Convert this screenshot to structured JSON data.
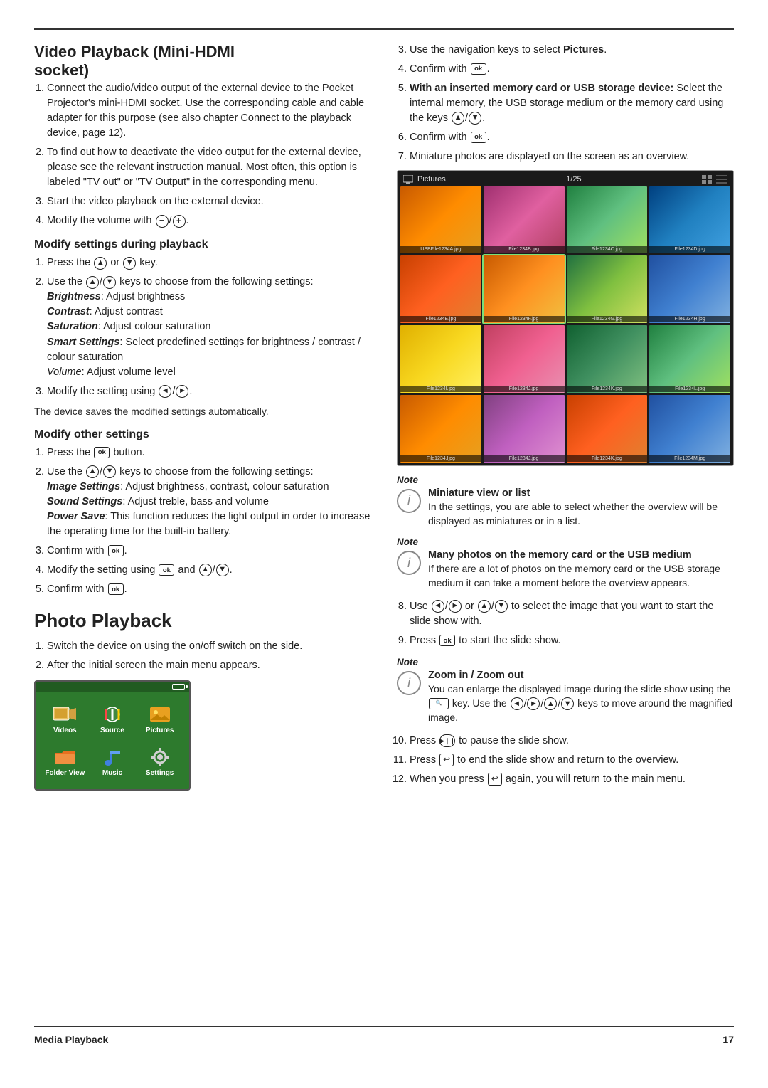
{
  "page": {
    "footer": {
      "left": "Media Playback",
      "right": "17"
    }
  },
  "left_column": {
    "section1": {
      "title_line1": "Video Playback (Mini-HDMI",
      "title_line2": "socket)",
      "items": [
        "Connect the audio/video output of the external device to the Pocket Projector's mini-HDMI socket. Use the corresponding cable and cable adapter for this purpose (see also chapter Connect to the playback device, page 12).",
        "To find out how to deactivate the video output for the external device, please see the relevant instruction manual. Most often, this option is labeled \"TV out\" or \"TV Output\" in the corresponding menu.",
        "Start the video playback on the external device.",
        "Modify the volume with"
      ],
      "item4_suffix": ".",
      "modify_settings": {
        "title": "Modify settings during playback",
        "items": [
          "Press the",
          "Use the",
          "Modify the setting using"
        ],
        "item1_middle": "or",
        "item1_suffix": "key.",
        "item2_middle": "keys to choose from the following settings:",
        "item3_suffix": ".",
        "settings_list": [
          {
            "name": "Brightness",
            "desc": "Adjust brightness"
          },
          {
            "name": "Contrast",
            "desc": "Adjust contrast"
          },
          {
            "name": "Saturation",
            "desc": "Adjust colour saturation"
          },
          {
            "name": "Smart Settings",
            "desc": "Select predefined settings for brightness / contrast / colour saturation"
          },
          {
            "name": "Volume",
            "desc": "Adjust volume level"
          }
        ],
        "auto_save": "The device saves the modified settings automatically."
      },
      "modify_other": {
        "title": "Modify other settings",
        "items": [
          "Press the",
          "Use the",
          "Confirm with",
          "Modify the setting using",
          "Confirm with"
        ],
        "item1_suffix": "button.",
        "item2_middle": "keys to choose from the following settings:",
        "item3_suffix": ".",
        "item4_middle": "and",
        "item4_suffix": ".",
        "item5_suffix": ".",
        "settings_list": [
          {
            "name": "Image Settings",
            "desc": "Adjust brightness, contrast, colour saturation"
          },
          {
            "name": "Sound Settings",
            "desc": "Adjust treble, bass and volume"
          },
          {
            "name": "Power Save",
            "desc": "This function reduces the light output in order to increase the operating time for the built-in battery."
          }
        ]
      }
    },
    "section2": {
      "title": "Photo Playback",
      "items": [
        "Switch the device on using the on/off switch on the side.",
        "After the initial screen the main menu appears."
      ],
      "menu_items": [
        {
          "label": "Videos",
          "icon": "film"
        },
        {
          "label": "Source",
          "icon": "source"
        },
        {
          "label": "Pictures",
          "icon": "pictures"
        },
        {
          "label": "Folder View",
          "icon": "folder"
        },
        {
          "label": "Music",
          "icon": "music"
        },
        {
          "label": "Settings",
          "icon": "settings"
        }
      ]
    }
  },
  "right_column": {
    "items_3_9": [
      "Use the navigation keys to select",
      "Confirm with",
      "With an inserted memory card or USB storage device:",
      "Confirm with",
      "Miniature photos are displayed on the screen as an overview."
    ],
    "item3_bold": "Pictures",
    "item5_prefix": "With an inserted memory card or USB storage device:",
    "item5_middle": "Select the internal memory, the USB storage medium or the memory card using the keys",
    "note1": {
      "title": "Miniature view or list",
      "text": "In the settings, you are able to select whether the overview will be displayed as miniatures or in a list."
    },
    "note2": {
      "title": "Many photos on the memory card or the USB medium",
      "text": "If there are a lot of photos on the memory card or the USB storage medium it can take a moment before the overview appears."
    },
    "items_8_12": [
      "Use",
      "Press",
      "Press",
      "Press",
      "When you press"
    ],
    "item8": "Use",
    "item8_middle": "or",
    "item8_middle2": "to select the image that you want to start the slide show with.",
    "item9": "Press",
    "item9_suffix": "to start the slide show.",
    "note3": {
      "title": "Zoom in / Zoom out",
      "text": "You can enlarge the displayed image during the slide show using the",
      "text2": "key. Use the",
      "text3": "keys to move around the magnified image."
    },
    "item10": "Press",
    "item10_suffix": "to pause the slide show.",
    "item11": "Press",
    "item11_suffix": "to end the slide show and return to the overview.",
    "item12": "When you press",
    "item12_suffix": "again, you will return to the main menu.",
    "pictures_grid": {
      "title": "Pictures",
      "count": "1/25",
      "thumbs": [
        {
          "label": "USBFile1234A.jpg",
          "color": "1"
        },
        {
          "label": "File1234B.jpg",
          "color": "2"
        },
        {
          "label": "File1234C.jpg",
          "color": "3"
        },
        {
          "label": "File1234D.jpg",
          "color": "4"
        },
        {
          "label": "File1234E.jpg",
          "color": "5"
        },
        {
          "label": "File1234F.jpg",
          "color": "6",
          "selected": true
        },
        {
          "label": "File1234G.jpg",
          "color": "7"
        },
        {
          "label": "File1234H.jpg",
          "color": "8"
        },
        {
          "label": "File1234I.jpg",
          "color": "9"
        },
        {
          "label": "File1234J.jpg",
          "color": "10"
        },
        {
          "label": "File1234K.jpg",
          "color": "11"
        },
        {
          "label": "File1234L.jpg",
          "color": "3"
        },
        {
          "label": "",
          "color": "1"
        },
        {
          "label": "",
          "color": "12"
        },
        {
          "label": "",
          "color": "5"
        },
        {
          "label": "File1234M.jpg",
          "color": "8"
        }
      ]
    }
  }
}
